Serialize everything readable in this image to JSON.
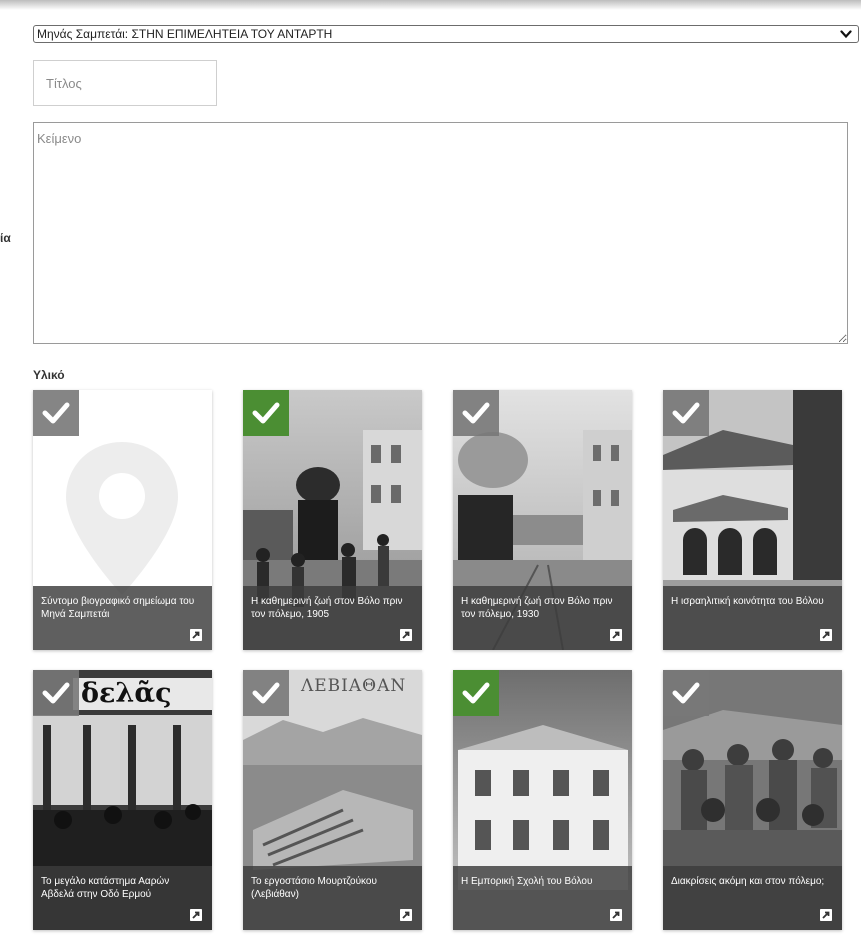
{
  "side_label": "ία",
  "select": {
    "value": "Μηνάς Σαμπετάι: ΣΤΗΝ ΕΠΙΜΕΛΗΤΕΙΑ ΤΟΥ ΑΝΤΑΡΤΗ",
    "icon": "chevron-down-icon"
  },
  "title_field": {
    "placeholder": "Τίτλος",
    "value": ""
  },
  "body_field": {
    "placeholder": "Κείμενο",
    "value": ""
  },
  "material": {
    "heading": "Υλικό",
    "items": [
      {
        "caption": "Σύντομο βιογραφικό σημείωμα του Μηνά Σαμπετάι",
        "selected": false,
        "image": "map-pin-placeholder"
      },
      {
        "caption": "Η καθημερινή ζωή στον Βόλο πριν τον πόλεμο, 1905",
        "selected": true,
        "image": "street-with-steam-train-photo"
      },
      {
        "caption": "Η καθημερινή ζωή στον Βόλο πριν τον πόλεμο, 1930",
        "selected": false,
        "image": "street-with-train-photo"
      },
      {
        "caption": "Η ισραηλιτική κοινότητα του Βόλου",
        "selected": false,
        "image": "synagogue-building-photo"
      },
      {
        "caption": "Το μεγάλο κατάστημα Ααρών Αβδελά στην Οδό Ερμού",
        "selected": false,
        "image": "storefront-crowd-photo",
        "sign_text": "δελᾶς"
      },
      {
        "caption": "Το εργοστάσιο Μουρτζούκου (Λεβιάθαν)",
        "selected": false,
        "image": "factory-aerial-photo",
        "sign_text": "ΛΕΒΙΑΘΑΝ"
      },
      {
        "caption": "Η Εμπορική Σχολή του Βόλου",
        "selected": true,
        "image": "school-building-photo"
      },
      {
        "caption": "Διακρίσεις ακόμη και στον πόλεμο;",
        "selected": false,
        "image": "soldiers-group-photo"
      }
    ]
  },
  "colors": {
    "selected_check": "#4b8e33",
    "unselected_check": "#787878",
    "caption_bg": "#3c3c3c"
  }
}
